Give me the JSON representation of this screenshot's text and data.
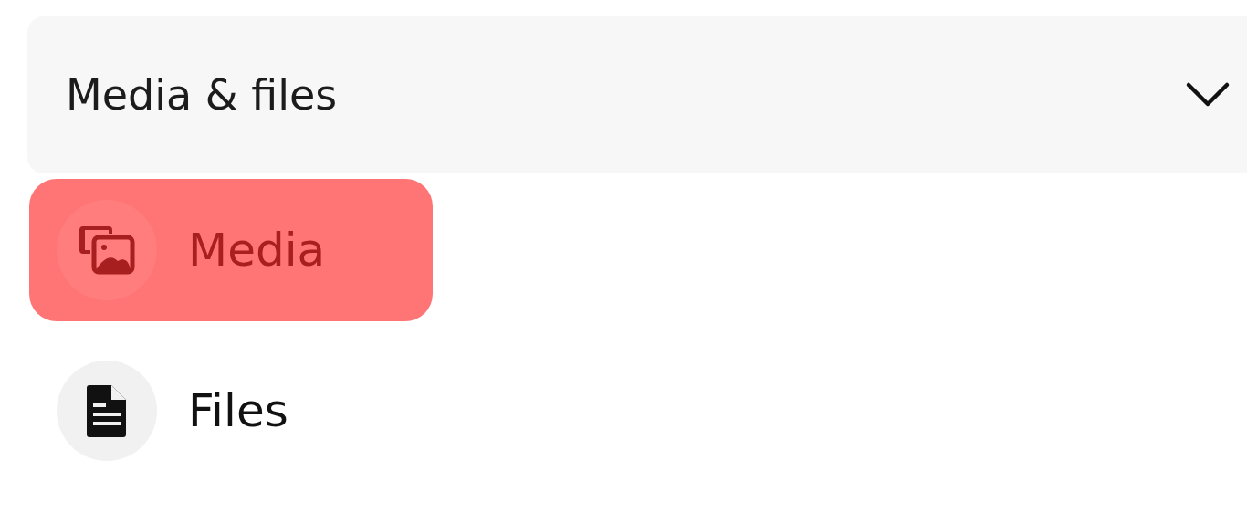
{
  "section": {
    "title": "Media & files",
    "expanded": true
  },
  "items": [
    {
      "label": "Media",
      "kind": "media",
      "selected": true
    },
    {
      "label": "Files",
      "kind": "files",
      "selected": false
    }
  ]
}
